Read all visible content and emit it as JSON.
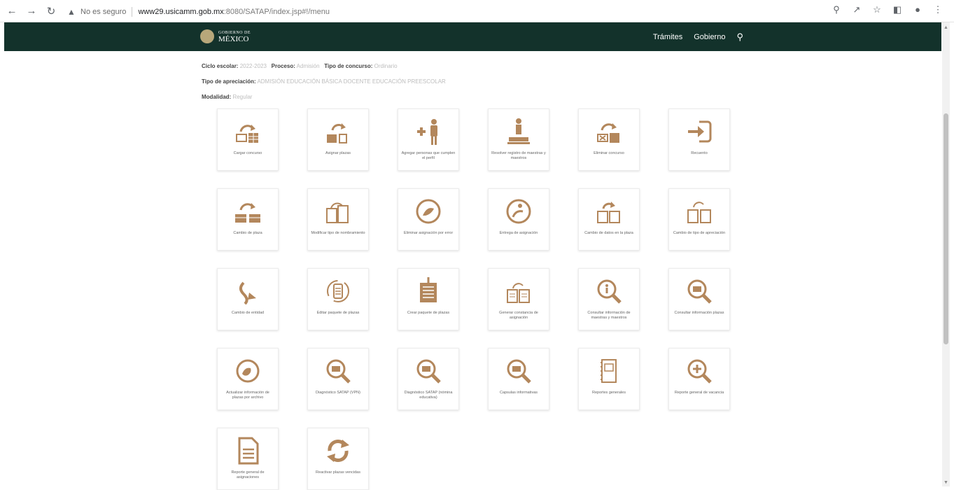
{
  "browser": {
    "security_label": "No es seguro",
    "url_host": "www29.usicamm.gob.mx",
    "url_path": ":8080/SATAP/index.jsp#!/menu"
  },
  "header": {
    "logo_small": "GOBIERNO DE",
    "logo_big": "MÉXICO",
    "nav_tramites": "Trámites",
    "nav_gobierno": "Gobierno"
  },
  "filters": {
    "ciclo_label": "Ciclo escolar:",
    "ciclo_value": "2022-2023",
    "proceso_label": "Proceso:",
    "proceso_value": "Admisión",
    "tipo_concurso_label": "Tipo de concurso:",
    "tipo_concurso_value": "Ordinario",
    "tipo_apreciacion_label": "Tipo de apreciación:",
    "tipo_apreciacion_value": "ADMISIÓN EDUCACIÓN BÁSICA DOCENTE EDUCACIÓN PREESCOLAR",
    "modalidad_label": "Modalidad:",
    "modalidad_value": "Regular"
  },
  "tiles": [
    {
      "label": "Cargar concurso",
      "icon": "upload-table-icon"
    },
    {
      "label": "Asignar plazas",
      "icon": "assign-places-icon"
    },
    {
      "label": "Agregar personas que cumplen el perfil",
      "icon": "add-person-icon"
    },
    {
      "label": "Resolver registro de maestras y maestros",
      "icon": "resolve-registry-icon"
    },
    {
      "label": "Eliminar concurso",
      "icon": "delete-contest-icon"
    },
    {
      "label": "Recuento",
      "icon": "login-arrow-icon"
    },
    {
      "label": "Cambio de plaza",
      "icon": "change-place-icon"
    },
    {
      "label": "Modificar tipo de nombramiento",
      "icon": "modify-appointment-icon"
    },
    {
      "label": "Eliminar asignación por error",
      "icon": "remove-assignment-icon"
    },
    {
      "label": "Entrega de asignación",
      "icon": "deliver-assignment-icon"
    },
    {
      "label": "Cambio de datos en la plaza",
      "icon": "change-data-icon"
    },
    {
      "label": "Cambio de tipo de apreciación",
      "icon": "change-type-icon"
    },
    {
      "label": "Cambio de entidad",
      "icon": "change-entity-icon"
    },
    {
      "label": "Editar paquete de plazas",
      "icon": "edit-package-icon"
    },
    {
      "label": "Crear paquete de plazas",
      "icon": "create-package-icon"
    },
    {
      "label": "Generar constancia de asignación",
      "icon": "certificate-icon"
    },
    {
      "label": "Consultar información de maestras y maestros",
      "icon": "search-person-icon"
    },
    {
      "label": "Consultar información plazas",
      "icon": "search-places-icon"
    },
    {
      "label": "Actualizar información de plazas por archivo",
      "icon": "update-file-icon"
    },
    {
      "label": "Diagnóstico SATAP (VPN)",
      "icon": "diagnostic-icon"
    },
    {
      "label": "Diagnóstico SATAP (nómina educativa)",
      "icon": "diagnostic-payroll-icon"
    },
    {
      "label": "Capsulas informativas",
      "icon": "capsules-icon"
    },
    {
      "label": "Reportes generales",
      "icon": "reports-icon"
    },
    {
      "label": "Reporte general de vacancia",
      "icon": "vacancy-report-icon"
    },
    {
      "label": "Reporte general de asignaciones",
      "icon": "assignments-report-icon"
    },
    {
      "label": "Reactivar plazas vencidas",
      "icon": "reactivate-icon"
    }
  ],
  "colors": {
    "accent": "#b3875c",
    "header_bg": "#13322b"
  }
}
